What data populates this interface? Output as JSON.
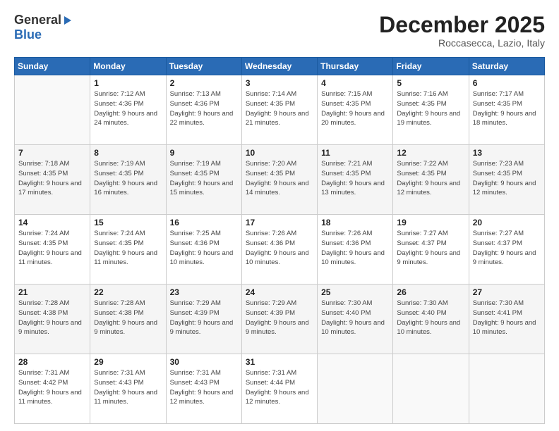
{
  "logo": {
    "general": "General",
    "blue": "Blue"
  },
  "header": {
    "month": "December 2025",
    "location": "Roccasecca, Lazio, Italy"
  },
  "weekdays": [
    "Sunday",
    "Monday",
    "Tuesday",
    "Wednesday",
    "Thursday",
    "Friday",
    "Saturday"
  ],
  "weeks": [
    [
      {
        "day": "",
        "sunrise": "",
        "sunset": "",
        "daylight": ""
      },
      {
        "day": "1",
        "sunrise": "Sunrise: 7:12 AM",
        "sunset": "Sunset: 4:36 PM",
        "daylight": "Daylight: 9 hours and 24 minutes."
      },
      {
        "day": "2",
        "sunrise": "Sunrise: 7:13 AM",
        "sunset": "Sunset: 4:36 PM",
        "daylight": "Daylight: 9 hours and 22 minutes."
      },
      {
        "day": "3",
        "sunrise": "Sunrise: 7:14 AM",
        "sunset": "Sunset: 4:35 PM",
        "daylight": "Daylight: 9 hours and 21 minutes."
      },
      {
        "day": "4",
        "sunrise": "Sunrise: 7:15 AM",
        "sunset": "Sunset: 4:35 PM",
        "daylight": "Daylight: 9 hours and 20 minutes."
      },
      {
        "day": "5",
        "sunrise": "Sunrise: 7:16 AM",
        "sunset": "Sunset: 4:35 PM",
        "daylight": "Daylight: 9 hours and 19 minutes."
      },
      {
        "day": "6",
        "sunrise": "Sunrise: 7:17 AM",
        "sunset": "Sunset: 4:35 PM",
        "daylight": "Daylight: 9 hours and 18 minutes."
      }
    ],
    [
      {
        "day": "7",
        "sunrise": "Sunrise: 7:18 AM",
        "sunset": "Sunset: 4:35 PM",
        "daylight": "Daylight: 9 hours and 17 minutes."
      },
      {
        "day": "8",
        "sunrise": "Sunrise: 7:19 AM",
        "sunset": "Sunset: 4:35 PM",
        "daylight": "Daylight: 9 hours and 16 minutes."
      },
      {
        "day": "9",
        "sunrise": "Sunrise: 7:19 AM",
        "sunset": "Sunset: 4:35 PM",
        "daylight": "Daylight: 9 hours and 15 minutes."
      },
      {
        "day": "10",
        "sunrise": "Sunrise: 7:20 AM",
        "sunset": "Sunset: 4:35 PM",
        "daylight": "Daylight: 9 hours and 14 minutes."
      },
      {
        "day": "11",
        "sunrise": "Sunrise: 7:21 AM",
        "sunset": "Sunset: 4:35 PM",
        "daylight": "Daylight: 9 hours and 13 minutes."
      },
      {
        "day": "12",
        "sunrise": "Sunrise: 7:22 AM",
        "sunset": "Sunset: 4:35 PM",
        "daylight": "Daylight: 9 hours and 12 minutes."
      },
      {
        "day": "13",
        "sunrise": "Sunrise: 7:23 AM",
        "sunset": "Sunset: 4:35 PM",
        "daylight": "Daylight: 9 hours and 12 minutes."
      }
    ],
    [
      {
        "day": "14",
        "sunrise": "Sunrise: 7:24 AM",
        "sunset": "Sunset: 4:35 PM",
        "daylight": "Daylight: 9 hours and 11 minutes."
      },
      {
        "day": "15",
        "sunrise": "Sunrise: 7:24 AM",
        "sunset": "Sunset: 4:35 PM",
        "daylight": "Daylight: 9 hours and 11 minutes."
      },
      {
        "day": "16",
        "sunrise": "Sunrise: 7:25 AM",
        "sunset": "Sunset: 4:36 PM",
        "daylight": "Daylight: 9 hours and 10 minutes."
      },
      {
        "day": "17",
        "sunrise": "Sunrise: 7:26 AM",
        "sunset": "Sunset: 4:36 PM",
        "daylight": "Daylight: 9 hours and 10 minutes."
      },
      {
        "day": "18",
        "sunrise": "Sunrise: 7:26 AM",
        "sunset": "Sunset: 4:36 PM",
        "daylight": "Daylight: 9 hours and 10 minutes."
      },
      {
        "day": "19",
        "sunrise": "Sunrise: 7:27 AM",
        "sunset": "Sunset: 4:37 PM",
        "daylight": "Daylight: 9 hours and 9 minutes."
      },
      {
        "day": "20",
        "sunrise": "Sunrise: 7:27 AM",
        "sunset": "Sunset: 4:37 PM",
        "daylight": "Daylight: 9 hours and 9 minutes."
      }
    ],
    [
      {
        "day": "21",
        "sunrise": "Sunrise: 7:28 AM",
        "sunset": "Sunset: 4:38 PM",
        "daylight": "Daylight: 9 hours and 9 minutes."
      },
      {
        "day": "22",
        "sunrise": "Sunrise: 7:28 AM",
        "sunset": "Sunset: 4:38 PM",
        "daylight": "Daylight: 9 hours and 9 minutes."
      },
      {
        "day": "23",
        "sunrise": "Sunrise: 7:29 AM",
        "sunset": "Sunset: 4:39 PM",
        "daylight": "Daylight: 9 hours and 9 minutes."
      },
      {
        "day": "24",
        "sunrise": "Sunrise: 7:29 AM",
        "sunset": "Sunset: 4:39 PM",
        "daylight": "Daylight: 9 hours and 9 minutes."
      },
      {
        "day": "25",
        "sunrise": "Sunrise: 7:30 AM",
        "sunset": "Sunset: 4:40 PM",
        "daylight": "Daylight: 9 hours and 10 minutes."
      },
      {
        "day": "26",
        "sunrise": "Sunrise: 7:30 AM",
        "sunset": "Sunset: 4:40 PM",
        "daylight": "Daylight: 9 hours and 10 minutes."
      },
      {
        "day": "27",
        "sunrise": "Sunrise: 7:30 AM",
        "sunset": "Sunset: 4:41 PM",
        "daylight": "Daylight: 9 hours and 10 minutes."
      }
    ],
    [
      {
        "day": "28",
        "sunrise": "Sunrise: 7:31 AM",
        "sunset": "Sunset: 4:42 PM",
        "daylight": "Daylight: 9 hours and 11 minutes."
      },
      {
        "day": "29",
        "sunrise": "Sunrise: 7:31 AM",
        "sunset": "Sunset: 4:43 PM",
        "daylight": "Daylight: 9 hours and 11 minutes."
      },
      {
        "day": "30",
        "sunrise": "Sunrise: 7:31 AM",
        "sunset": "Sunset: 4:43 PM",
        "daylight": "Daylight: 9 hours and 12 minutes."
      },
      {
        "day": "31",
        "sunrise": "Sunrise: 7:31 AM",
        "sunset": "Sunset: 4:44 PM",
        "daylight": "Daylight: 9 hours and 12 minutes."
      },
      {
        "day": "",
        "sunrise": "",
        "sunset": "",
        "daylight": ""
      },
      {
        "day": "",
        "sunrise": "",
        "sunset": "",
        "daylight": ""
      },
      {
        "day": "",
        "sunrise": "",
        "sunset": "",
        "daylight": ""
      }
    ]
  ]
}
